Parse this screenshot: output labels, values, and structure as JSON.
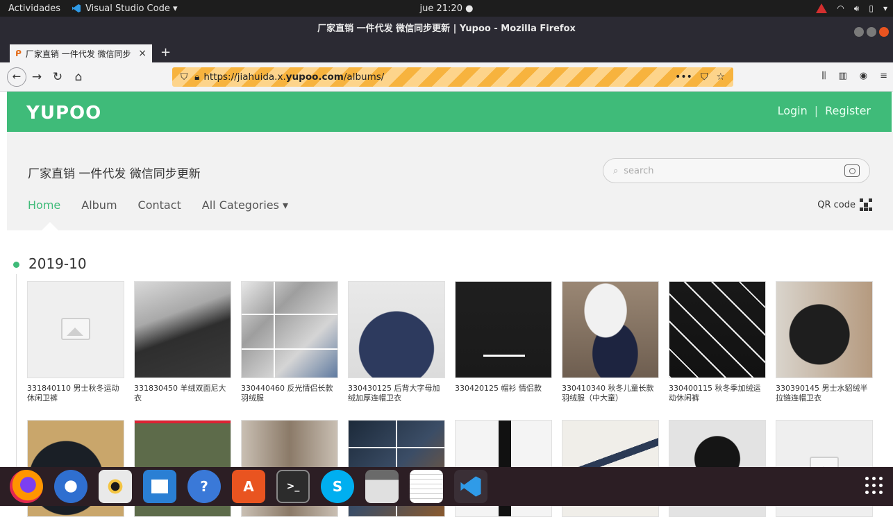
{
  "system": {
    "activities": "Actividades",
    "app_name": "Visual Studio Code ▾",
    "clock": "jue 21:20 ●"
  },
  "browser": {
    "window_title": "厂家直销 一件代发 微信同步更新 | Yupoo - Mozilla Firefox",
    "tab_title": "厂家直销 一件代发 微信同步",
    "tab_close": "×",
    "new_tab": "+",
    "url_prefix": "https://jiahuida.x.",
    "url_host": "yupoo.com",
    "url_suffix": "/albums/"
  },
  "site": {
    "logo": "YUPOO",
    "login": "Login",
    "separator": "|",
    "register": "Register",
    "store_title": "厂家直销 一件代发 微信同步更新",
    "search_placeholder": "search",
    "nav": {
      "home": "Home",
      "album": "Album",
      "contact": "Contact",
      "all_categories": "All Categories ▾"
    },
    "qr_label": "QR code"
  },
  "albums": {
    "date": "2019-10",
    "row1": [
      {
        "caption": "331840110 男士秋冬运动休闲卫裤",
        "color": "#efefef",
        "placeholder": true
      },
      {
        "caption": "331830450 羊绒双面尼大衣",
        "color": "#6b6b6b"
      },
      {
        "caption": "330440460 反光情侣长款羽绒服",
        "color": "#bfbfbf"
      },
      {
        "caption": "330430125 后背大字母加绒加厚连帽卫衣",
        "color": "#3a4a6b"
      },
      {
        "caption": "330420125 帽衫 情侣款",
        "color": "#2a2a2a"
      },
      {
        "caption": "330410340 秋冬儿童长款羽绒服（中大童）",
        "color": "#8a7a6a"
      },
      {
        "caption": "330400115 秋冬季加绒运动休闲裤",
        "color": "#1e1e1e"
      },
      {
        "caption": "330390145 男士水貂绒半拉链连帽卫衣",
        "color": "#3a3a3a"
      }
    ],
    "row2": [
      {
        "color": "#2b2f36"
      },
      {
        "color": "#5d6b4a"
      },
      {
        "color": "#9a8c7d"
      },
      {
        "color": "#334455"
      },
      {
        "color": "#f4f4f4"
      },
      {
        "color": "#e9e7e3"
      },
      {
        "color": "#d8d8d8"
      },
      {
        "color": "#efefef",
        "placeholder": true
      }
    ]
  },
  "dock": {
    "apps": [
      "firefox-icon",
      "thunderbird-icon",
      "rhythmbox-icon",
      "writer-icon",
      "help-icon",
      "software-icon",
      "terminal-icon",
      "skype-icon",
      "files-icon",
      "text-editor-icon",
      "vscode-icon"
    ],
    "terminal_glyph": ">_",
    "skype_glyph": "S",
    "help_glyph": "?",
    "software_glyph": "A"
  },
  "colors": {
    "brand_green": "#3fbb79",
    "url_bar_stripe": "#f7b33e",
    "dock_bg": "#2c1e24"
  }
}
